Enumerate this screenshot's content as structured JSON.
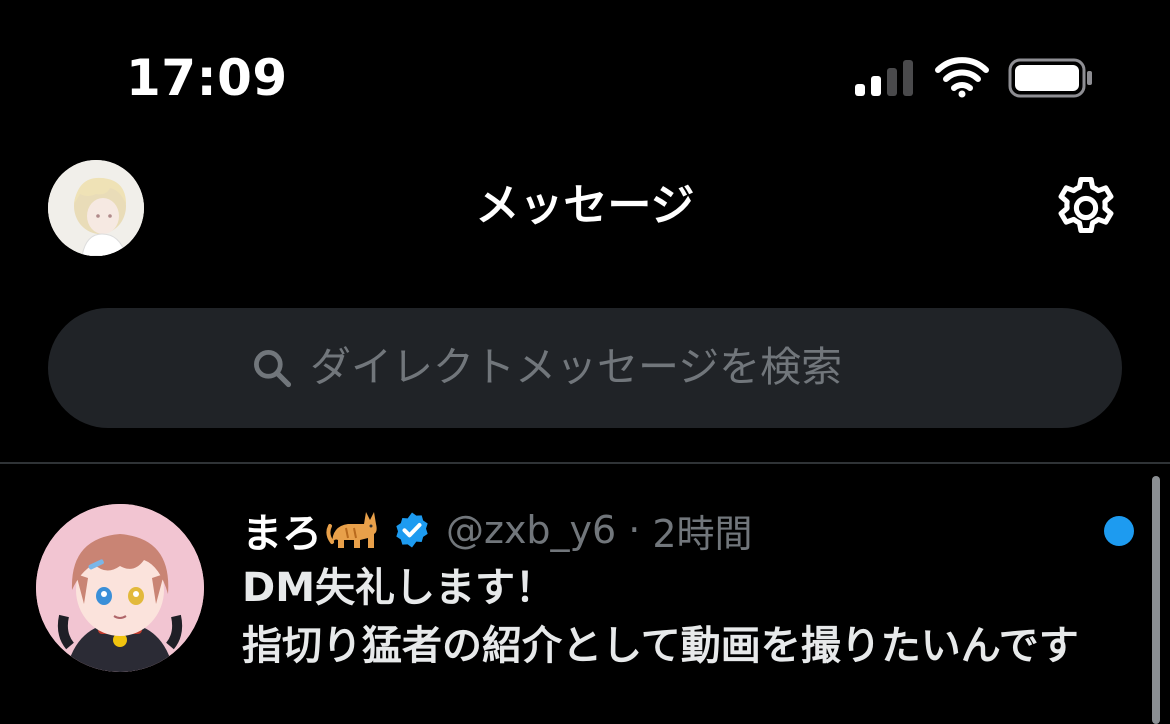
{
  "status_bar": {
    "time": "17:09",
    "signal_bars": 2,
    "battery_level": 1.0
  },
  "header": {
    "title": "メッセージ",
    "settings_icon": "gear-icon"
  },
  "search": {
    "placeholder": "ダイレクトメッセージを検索",
    "icon": "search-icon"
  },
  "conversations": [
    {
      "name": "まろ",
      "emoji_icon": "cat-icon",
      "verified": true,
      "handle": "@zxb_y6",
      "separator": "·",
      "time": "2時間",
      "unread": true,
      "preview_line1": "DM失礼します！",
      "preview_line2": "指切り猛者の紹介として動画を撮りたいんです"
    }
  ],
  "colors": {
    "background": "#000000",
    "accent": "#1d9bf0",
    "secondary_text": "#71767b",
    "search_bg": "#202327"
  }
}
